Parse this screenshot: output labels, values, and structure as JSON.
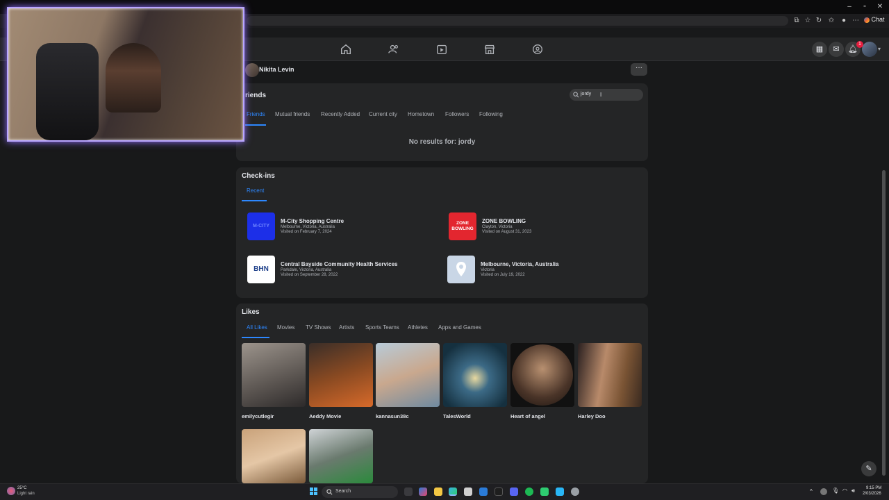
{
  "browser": {
    "chat_label": "Chat",
    "window_controls": [
      "minimize-icon",
      "restore-icon",
      "close-icon"
    ]
  },
  "nav": {
    "icons": [
      "home-icon",
      "friends-icon",
      "video-icon",
      "marketplace-icon",
      "groups-icon"
    ],
    "notification_count": "1"
  },
  "profile": {
    "name": "Nikita Levin",
    "more_label": "···"
  },
  "friends": {
    "title": "riends",
    "search_value": "jordy",
    "tabs": [
      "Friends",
      "Mutual friends",
      "Recently Added",
      "Current city",
      "Hometown",
      "Followers",
      "Following"
    ],
    "no_results": "No results for: jordy"
  },
  "checkins": {
    "title": "Check-ins",
    "tab": "Recent",
    "items": [
      {
        "logo": "M-CITY",
        "name": "M-City Shopping Centre",
        "location": "Melbourne, Victoria, Australia",
        "visited": "Visited on February 7, 2024",
        "color": "#1c2fe8"
      },
      {
        "logo": "ZONE BOWLING",
        "name": "ZONE BOWLING",
        "location": "Clayton, Victoria",
        "visited": "Visited on August 31, 2023",
        "color": "#e3262f"
      },
      {
        "logo": "BHN",
        "name": "Central Bayside Community Health Services",
        "location": "Parkdale, Victoria, Australia",
        "visited": "Visited on September 28, 2022",
        "color": "#ffffff"
      },
      {
        "logo": "map-pin-icon",
        "name": "Melbourne, Victoria, Australia",
        "location": "Victoria",
        "visited": "Visited on July 19, 2022",
        "color": "#c9d6e6"
      }
    ]
  },
  "likes": {
    "title": "Likes",
    "tabs": [
      "All Likes",
      "Movies",
      "TV Shows",
      "Artists",
      "Sports Teams",
      "Athletes",
      "Apps and Games"
    ],
    "items": [
      {
        "name": "emilycutlegir",
        "color": "#6f6a66"
      },
      {
        "name": "Aeddy Movie",
        "color": "#7a4a2c"
      },
      {
        "name": "kannasun38c",
        "color": "#8fa6b6"
      },
      {
        "name": "TalesWorld",
        "color": "#244a63"
      },
      {
        "name": "Heart of angel",
        "color": "#3b2e24"
      },
      {
        "name": "Harley Doo",
        "color": "#6a4e3a"
      },
      {
        "name": "",
        "color": "#b09070"
      },
      {
        "name": "",
        "color": "#5a6a5a"
      }
    ]
  },
  "taskbar": {
    "weather_temp": "25°C",
    "weather_desc": "Light rain",
    "search_label": "Search",
    "time": "9:15 PM",
    "date": "2/03/2026"
  }
}
